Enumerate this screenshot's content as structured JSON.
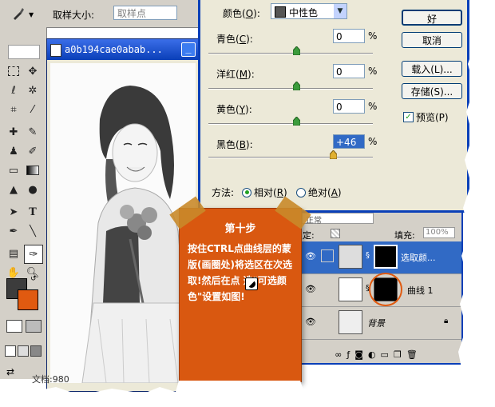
{
  "options_bar": {
    "sample_size_label": "取样大小:",
    "sample_size_value": "取样点"
  },
  "document": {
    "title": "a0b194cae0abab..."
  },
  "dialog": {
    "colors_label": "颜色(",
    "colors_key": "O",
    "colors_value": "中性色",
    "rows": [
      {
        "label": "青色(",
        "key": "C",
        "value": "0",
        "pct": "%"
      },
      {
        "label": "洋红(",
        "key": "M",
        "value": "0",
        "pct": "%"
      },
      {
        "label": "黄色(",
        "key": "Y",
        "value": "0",
        "pct": "%"
      },
      {
        "label": "黑色(",
        "key": "B",
        "value": "+46",
        "pct": "%"
      }
    ],
    "method_label": "方法:",
    "relative_label": "相对(",
    "relative_key": "R",
    "absolute_label": "绝对(",
    "absolute_key": "A",
    "buttons": {
      "ok": "好",
      "cancel": "取消",
      "load": "载入(L)...",
      "save": "存储(S)...",
      "preview": "预览(P)"
    }
  },
  "layers": {
    "blend_mode": "正常",
    "lock_label": "锁定:",
    "fill_label": "填充:",
    "fill_value": "100%",
    "items": [
      {
        "name": "选取颜..."
      },
      {
        "name": "曲线 1"
      },
      {
        "name": "背景"
      }
    ]
  },
  "status": {
    "doc_label": "文档:980"
  },
  "annotation": {
    "title": "第十步",
    "body": "按住CTRL点曲线层的蒙版(画圈处)将选区在次选取!然后在点    选\"可选颜色\"设置如图!"
  },
  "colors": {
    "accent": "#0a3fb8",
    "note": "#d95810",
    "foreground": "#3c3c3c",
    "background": "#e05a10"
  }
}
